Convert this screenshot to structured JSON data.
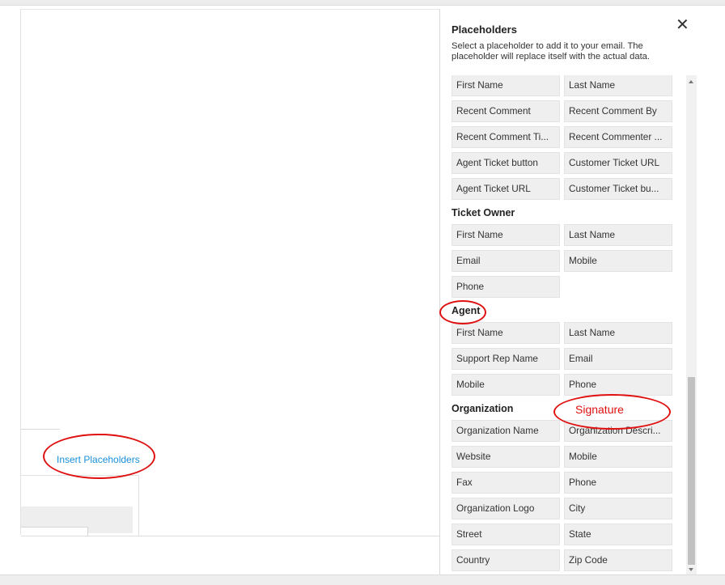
{
  "main": {
    "insert_placeholders_link": "Insert Placeholders"
  },
  "panel": {
    "title": "Placeholders",
    "close_label": "✕",
    "description": "Select a placeholder to add it to your email. The placeholder will replace itself with the actual data.",
    "ticket_items": [
      "First Name",
      "Last Name",
      "Recent Comment",
      "Recent Comment By",
      "Recent Comment Ti...",
      "Recent Commenter ...",
      "Agent Ticket button",
      "Customer Ticket URL",
      "Agent Ticket URL",
      "Customer Ticket bu..."
    ],
    "sections": [
      {
        "title": "Ticket Owner",
        "items": [
          "First Name",
          "Last Name",
          "Email",
          "Mobile",
          "Phone"
        ]
      },
      {
        "title": "Agent",
        "items": [
          "First Name",
          "Last Name",
          "Support Rep Name",
          "Email",
          "Mobile",
          "Phone"
        ]
      },
      {
        "title": "Organization",
        "items": [
          "Organization Name",
          "Organization Descri...",
          "Website",
          "Mobile",
          "Fax",
          "Phone",
          "Organization Logo",
          "City",
          "Street",
          "State",
          "Country",
          "Zip Code"
        ]
      }
    ]
  },
  "annotation": {
    "signature_note": "Signature",
    "color": "#e01010"
  }
}
